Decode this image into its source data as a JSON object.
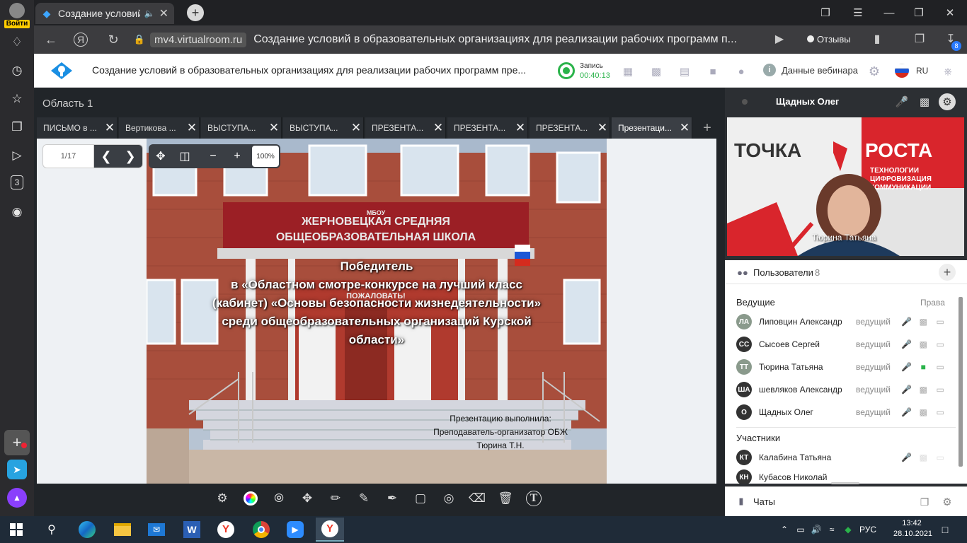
{
  "sidebar": {
    "login_label": "Войти",
    "items": [
      {
        "icon": "bell-icon",
        "glyph": "🔔"
      },
      {
        "icon": "history-icon",
        "glyph": "◷"
      },
      {
        "icon": "star-icon",
        "glyph": "☆"
      },
      {
        "icon": "collections-icon",
        "glyph": "❐"
      },
      {
        "icon": "play-icon",
        "glyph": "▷"
      },
      {
        "icon": "number-three-icon",
        "glyph": "3"
      },
      {
        "icon": "camera-icon",
        "glyph": "◙"
      }
    ]
  },
  "browser": {
    "tab_title": "Создание условий в",
    "url_domain": "mv4.virtualroom.ru",
    "page_title": "Создание условий в образовательных организациях для реализации рабочих программ п...",
    "reviews_label": "Отзывы",
    "downloads_count": "8"
  },
  "webinar": {
    "title": "Создание условий в образовательных организациях для реализации рабочих программ пре...",
    "record_label": "Запись",
    "record_time": "00:40:13",
    "info_label": "Данные вебинара",
    "language": "RU",
    "accent_color": "#1a8fe3",
    "record_color": "#2ab34a"
  },
  "main": {
    "area_title": "Область 1",
    "tabs": [
      {
        "label": "ПИСЬМО в ...",
        "active": false
      },
      {
        "label": "Вертикова ...",
        "active": false
      },
      {
        "label": "ВЫСТУПА...",
        "active": false
      },
      {
        "label": "ВЫСТУПА...",
        "active": false
      },
      {
        "label": "ПРЕЗЕНТА...",
        "active": false
      },
      {
        "label": "ПРЕЗЕНТА...",
        "active": false
      },
      {
        "label": "ПРЕЗЕНТА...",
        "active": false
      },
      {
        "label": "Презентаци...",
        "active": true
      }
    ],
    "page_indicator": "1/17",
    "zoom": "100%",
    "slide": {
      "lines": [
        "Победитель",
        "в «Областном смотре-конкурсе на лучший класс",
        "(кабинет) «Основы безопасности жизнедеятельности»",
        "среди общеобразовательных организаций Курской",
        "области»"
      ],
      "credit": [
        "Презентацию выполнила:",
        "Преподаватель-организатор ОБЖ",
        "Тюрина Т.Н."
      ],
      "sign_top": "МБОУ",
      "sign_line1": "ЖЕРНОВЕЦКАЯ СРЕДНЯЯ",
      "sign_line2": "ОБЩЕОБРАЗОВАТЕЛЬНАЯ ШКОЛА",
      "welcome": "ПОЖАЛОВАТЬ!"
    },
    "tools": [
      "gear-icon",
      "color-wheel-icon",
      "pointer-icon",
      "move-icon",
      "brush-icon",
      "pencil-icon",
      "pen-icon",
      "frame-icon",
      "target-icon",
      "eraser-icon",
      "trash-icon",
      "text-icon"
    ]
  },
  "right_panel": {
    "speaker_name": "Щадных Олег",
    "camera_label": "Тюрина Татьяна",
    "banner_line1": "ТОЧКА",
    "banner_line2": "РОСТА",
    "banner_sub1": "ТЕХНОЛОГИИ",
    "banner_sub2": "ЦИФРОВИЗАЦИЯ",
    "banner_sub3": "КОММУНИКАЦИИ",
    "users_title": "Пользователи",
    "users_count": "8",
    "hosts_title": "Ведущие",
    "rights_label": "Права",
    "hosts": [
      {
        "initials": "ЛА",
        "name": "Липовцин Александр",
        "role": "ведущий",
        "color": "#8a9a8c",
        "mic_on": false
      },
      {
        "initials": "СС",
        "name": "Сысоев Сергей",
        "role": "ведущий",
        "color": "#333333",
        "mic_on": false
      },
      {
        "initials": "ТТ",
        "name": "Тюрина Татьяна",
        "role": "ведущий",
        "color": "#8a9a8c",
        "mic_on": true
      },
      {
        "initials": "ША",
        "name": "шевляков Александр",
        "role": "ведущий",
        "color": "#333333",
        "mic_on": false
      },
      {
        "initials": "О",
        "name": "Щадных Олег",
        "role": "ведущий",
        "color": "#333333",
        "mic_on": false
      }
    ],
    "participants_title": "Участники",
    "participants": [
      {
        "initials": "КТ",
        "name": "Калабина Татьяна",
        "color": "#333333"
      },
      {
        "initials": "КН",
        "name": "Кубасов Николай",
        "color": "#333333"
      }
    ],
    "chats_label": "Чаты"
  },
  "taskbar": {
    "apps": [
      "start-icon",
      "search-icon",
      "edge-icon",
      "explorer-icon",
      "mail-icon",
      "word-icon",
      "yandex-icon",
      "chrome-icon",
      "zoom-icon",
      "yandex-browser-icon"
    ],
    "lang": "РУС",
    "time": "13:42",
    "date": "28.10.2021"
  }
}
